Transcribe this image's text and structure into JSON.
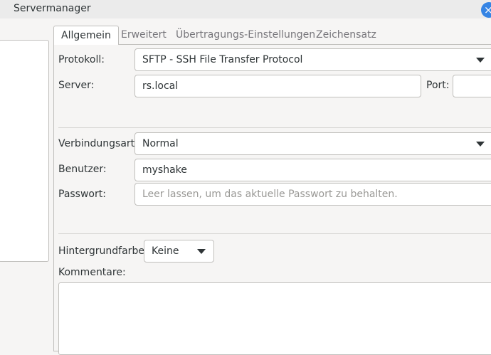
{
  "window": {
    "title": "Servermanager",
    "close_glyph": "×"
  },
  "tabs": [
    {
      "label": "Allgemein",
      "active": true
    },
    {
      "label": "Erweitert",
      "active": false
    },
    {
      "label": "Übertragungs-Einstellungen",
      "active": false
    },
    {
      "label": "Zeichensatz",
      "active": false
    }
  ],
  "form": {
    "protocol": {
      "label": "Protokoll:",
      "value": "SFTP - SSH File Transfer Protocol"
    },
    "server": {
      "label": "Server:",
      "value": "rs.local"
    },
    "port": {
      "label": "Port:",
      "value": ""
    },
    "connection_type": {
      "label": "Verbindungsart:",
      "value": "Normal"
    },
    "user": {
      "label": "Benutzer:",
      "value": "myshake"
    },
    "password": {
      "label": "Passwort:",
      "placeholder": "Leer lassen, um das aktuelle Passwort zu behalten."
    },
    "background_color": {
      "label": "Hintergrundfarbe:",
      "value": "Keine"
    },
    "comments": {
      "label": "Kommentare:",
      "value": ""
    }
  },
  "colors": {
    "accent": "#3584e4"
  },
  "icons": {
    "dropdown": "chevron-down-icon",
    "close": "close-icon"
  }
}
